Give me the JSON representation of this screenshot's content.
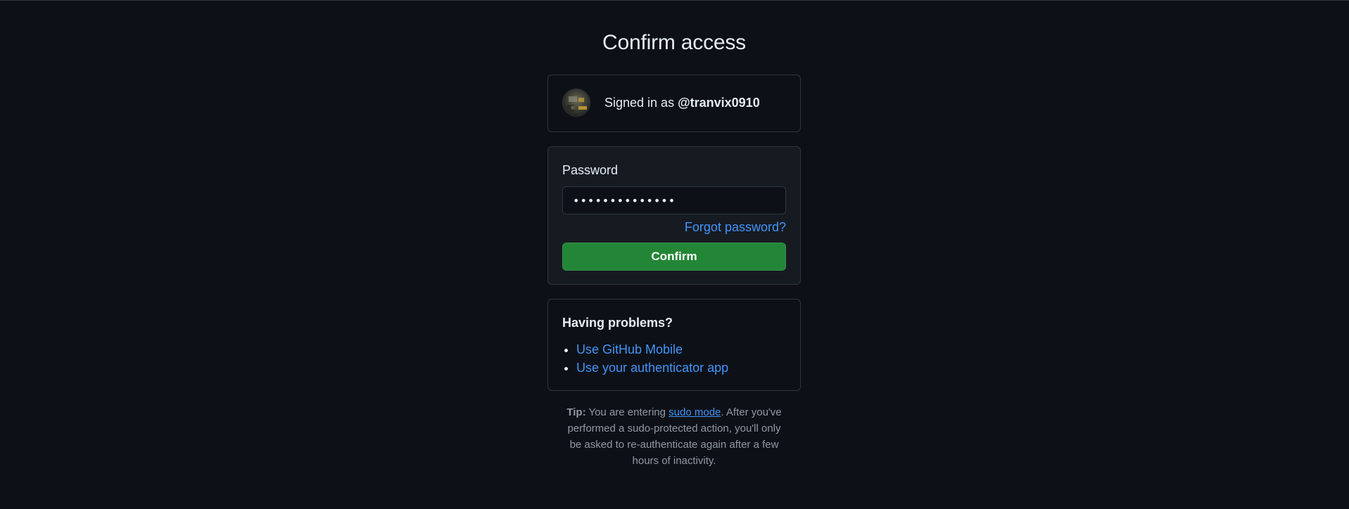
{
  "page": {
    "title": "Confirm access"
  },
  "signed_in": {
    "prefix": "Signed in as ",
    "username": "@tranvix0910"
  },
  "password_form": {
    "label": "Password",
    "value": "••••••••••••••",
    "forgot_link": "Forgot password?",
    "confirm_label": "Confirm"
  },
  "problems": {
    "title": "Having problems?",
    "items": [
      {
        "label": "Use GitHub Mobile"
      },
      {
        "label": "Use your authenticator app"
      }
    ]
  },
  "tip": {
    "bold": "Tip:",
    "before_link": " You are entering ",
    "link": "sudo mode",
    "after_link": ". After you've performed a sudo-protected action, you'll only be asked to re-authenticate again after a few hours of inactivity."
  },
  "colors": {
    "background": "#0d1117",
    "card_alt": "#161b22",
    "border": "#30363d",
    "link": "#4493f8",
    "button": "#238636"
  }
}
